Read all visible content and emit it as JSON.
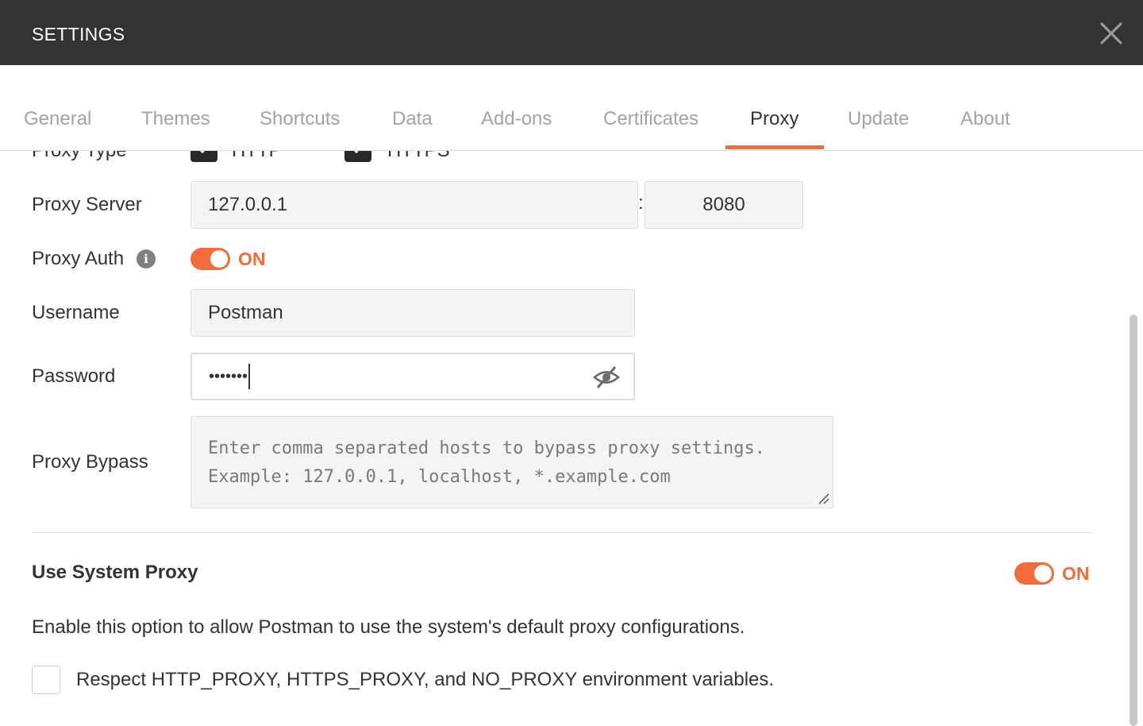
{
  "window": {
    "title": "SETTINGS",
    "close_icon": "close-icon"
  },
  "tabs": [
    {
      "label": "General"
    },
    {
      "label": "Themes"
    },
    {
      "label": "Shortcuts"
    },
    {
      "label": "Data"
    },
    {
      "label": "Add-ons"
    },
    {
      "label": "Certificates"
    },
    {
      "label": "Proxy",
      "active": true
    },
    {
      "label": "Update"
    },
    {
      "label": "About"
    }
  ],
  "proxy": {
    "type_label": "Proxy Type",
    "http_label": "HTTP",
    "http_checked": true,
    "https_label": "HTTPS",
    "https_checked": true,
    "server_label": "Proxy Server",
    "server_host": "127.0.0.1",
    "server_separator": ":",
    "server_port": "8080",
    "auth_label": "Proxy Auth",
    "auth_info_icon": "i",
    "auth_toggle_text": "ON",
    "username_label": "Username",
    "username_value": "Postman",
    "password_label": "Password",
    "password_masked": "•••••••",
    "bypass_label": "Proxy Bypass",
    "bypass_placeholder": "Enter comma separated hosts to bypass proxy settings.\nExample: 127.0.0.1, localhost, *.example.com"
  },
  "system_proxy": {
    "heading": "Use System Proxy",
    "toggle_text": "ON",
    "description": "Enable this option to allow Postman to use the system's default proxy configurations.",
    "env_checkbox_label": "Respect HTTP_PROXY, HTTPS_PROXY, and NO_PROXY environment variables.",
    "env_checked": false
  },
  "colors": {
    "accent": "#f26b3a",
    "titlebar": "#333333",
    "muted_tab": "#a3a3a3"
  }
}
